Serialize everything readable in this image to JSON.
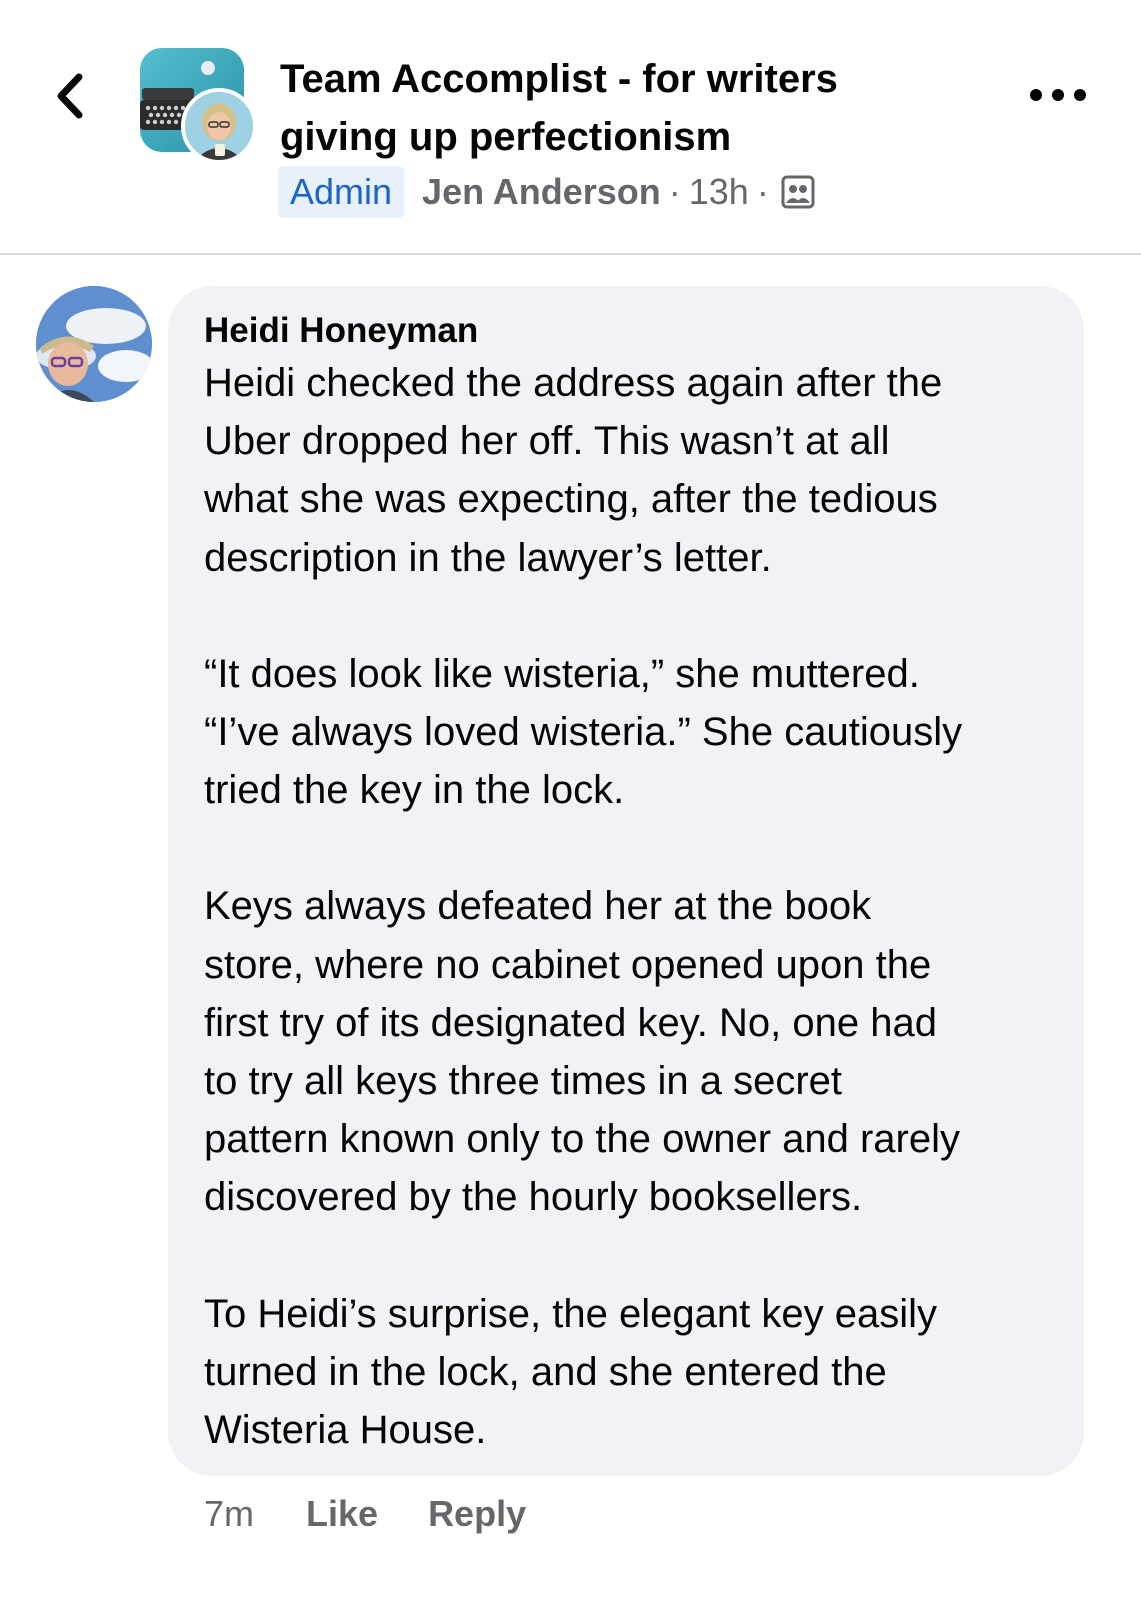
{
  "header": {
    "back_icon": "chevron-left-icon",
    "group_title_line1": "Team Accomplist - for writers",
    "group_title_line2": "giving up perfectionism",
    "admin_badge": "Admin",
    "author": "Jen Anderson",
    "separator": "·",
    "time": "13h",
    "audience_icon": "group-icon",
    "more_icon": "more-horizontal-icon"
  },
  "comment": {
    "author": "Heidi Honeyman",
    "paragraphs": [
      [
        "Heidi checked the address again after the",
        "Uber dropped her off. This wasn’t at all",
        "what she was expecting, after the tedious",
        "description in the lawyer’s letter."
      ],
      [
        "“It does look like wisteria,” she muttered.",
        "“I’ve always loved wisteria.” She cautiously",
        "tried the key in the lock."
      ],
      [
        "Keys always defeated her at the book",
        "store, where no cabinet opened upon the",
        "first try of its designated key. No, one had",
        "to try all keys three times in a secret",
        "pattern known only to the owner and rarely",
        "discovered by the hourly booksellers."
      ],
      [
        "To Heidi’s surprise, the elegant key easily",
        "turned in the lock, and she entered the",
        "Wisteria House."
      ]
    ],
    "time": "7m",
    "like_label": "Like",
    "reply_label": "Reply"
  },
  "colors": {
    "bubble_bg": "#f0f2f5",
    "admin_badge_bg": "#e7f0fb",
    "admin_badge_text": "#1b64c8",
    "secondary_text": "#65676b"
  }
}
